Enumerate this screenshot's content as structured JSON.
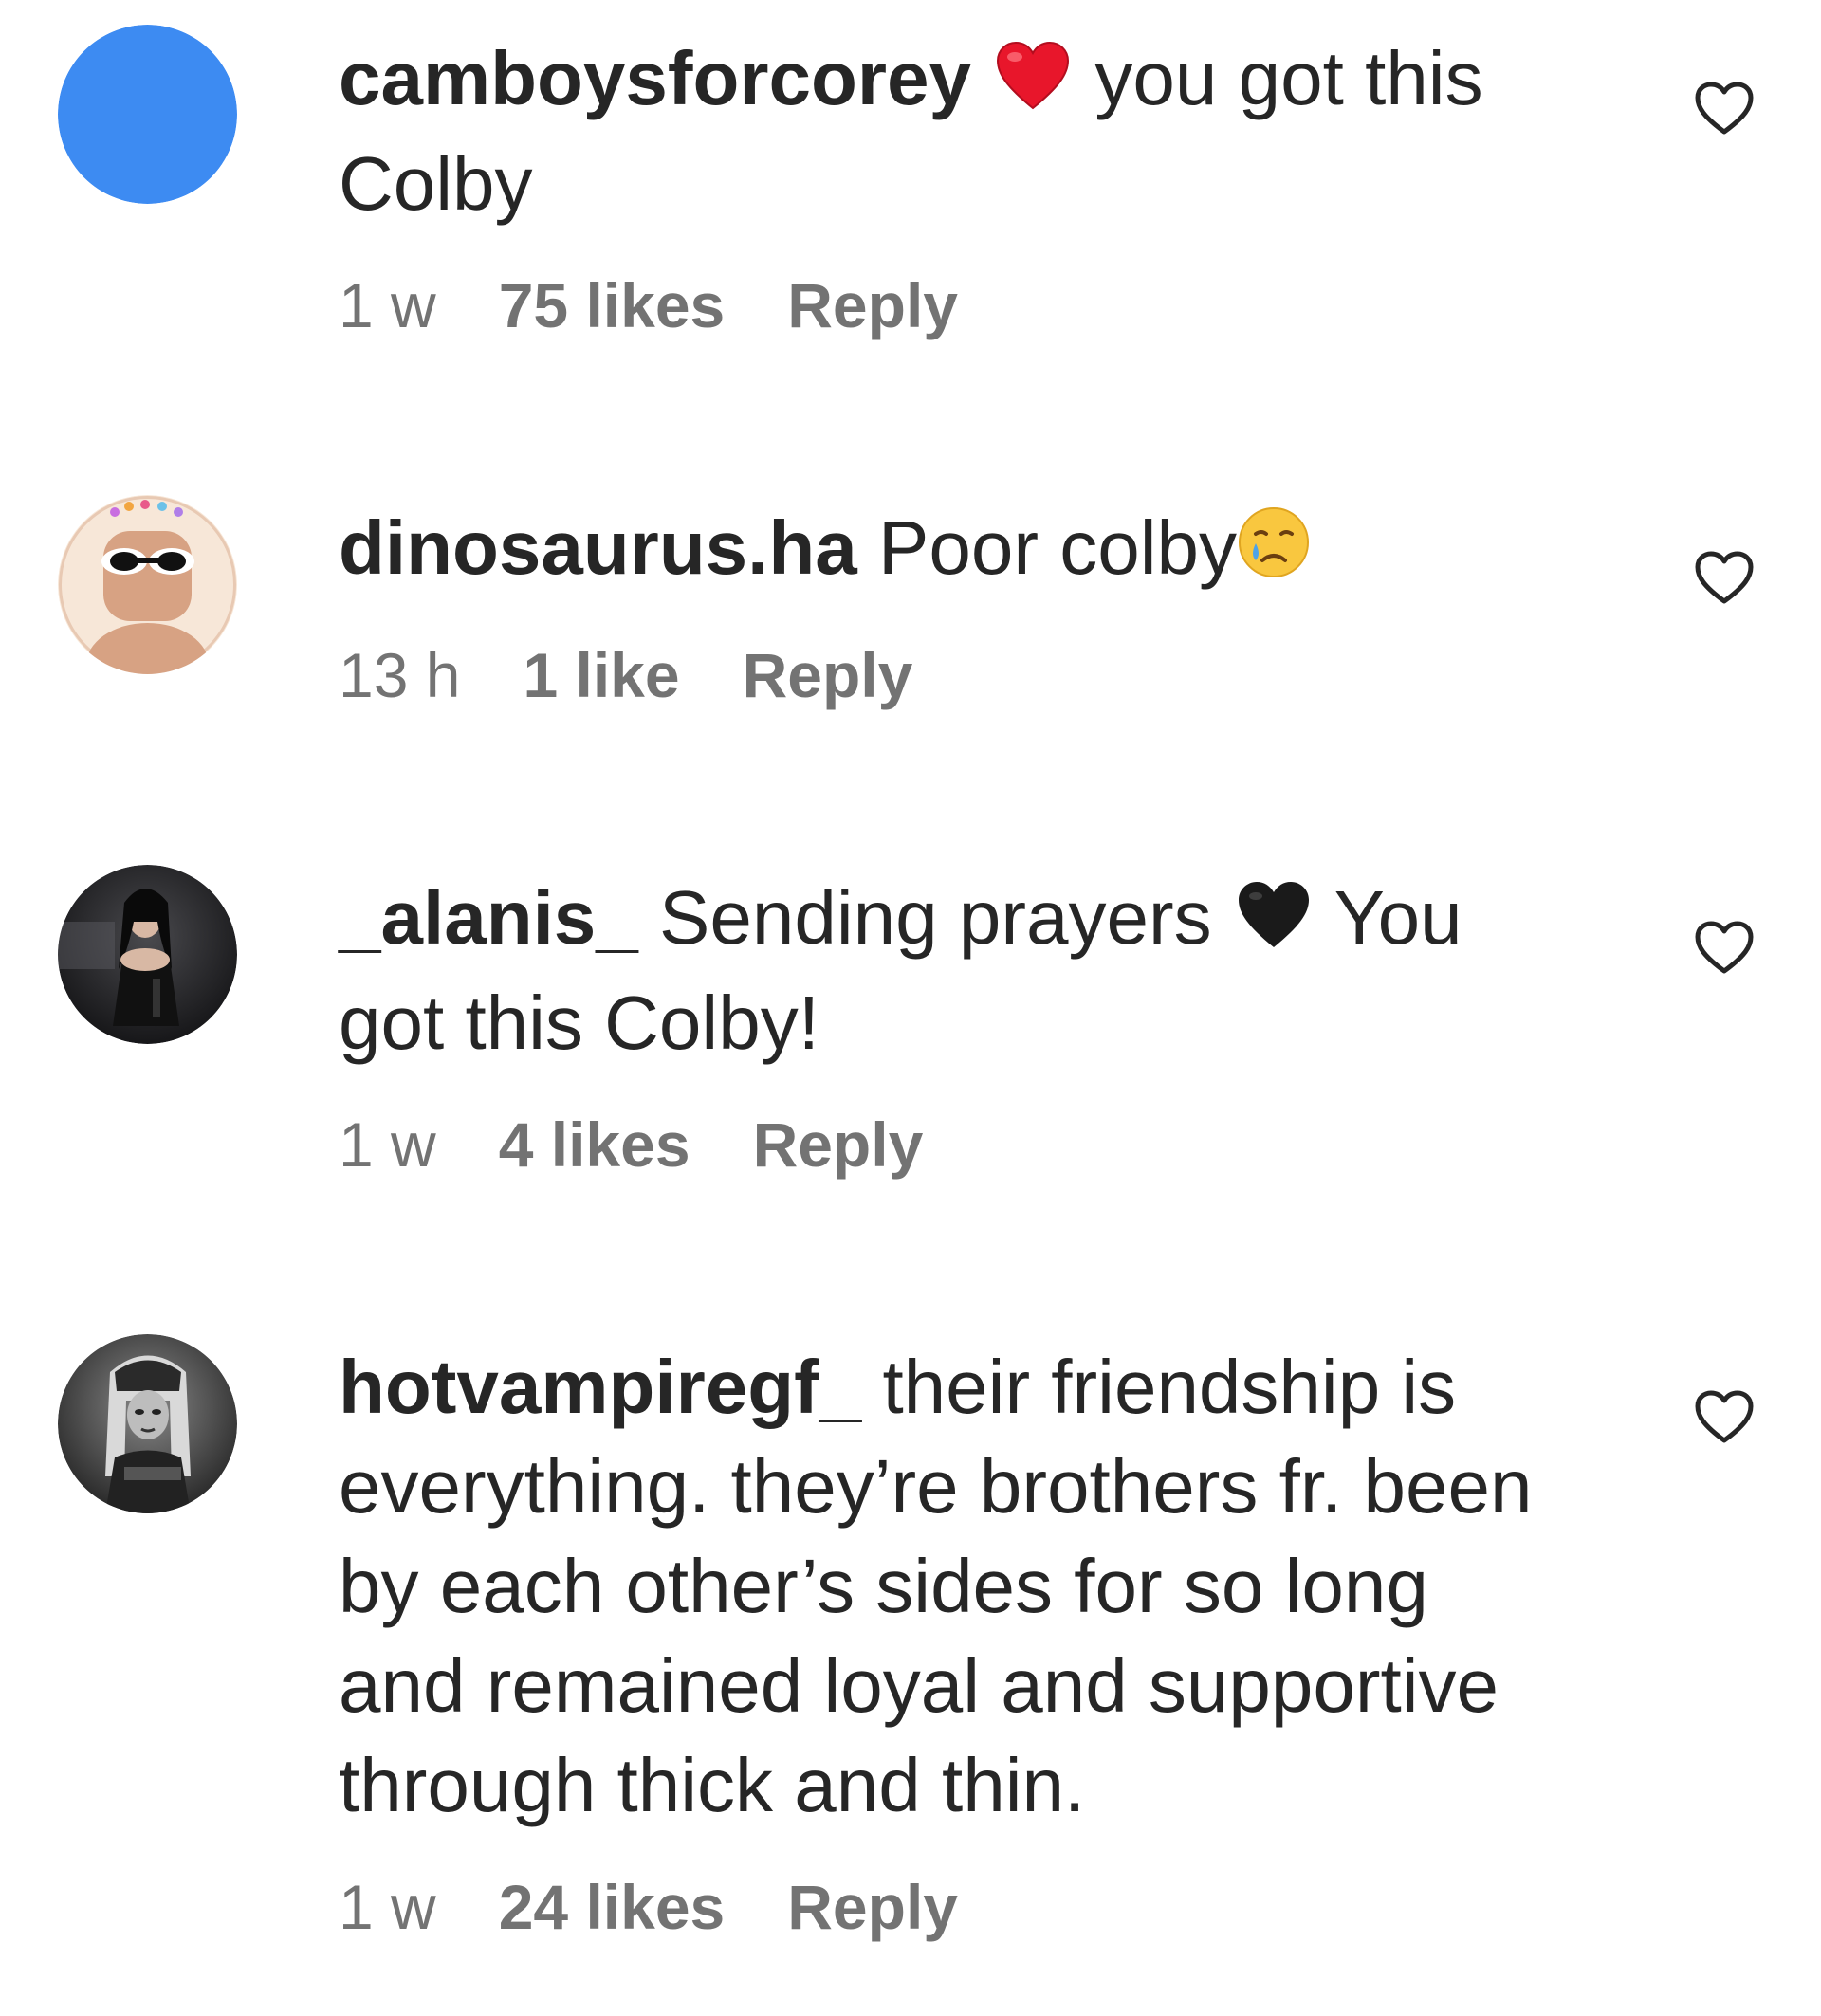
{
  "colors": {
    "text": "#262626",
    "meta": "#737373",
    "avatar_blue": "#3d8bf2"
  },
  "comments": [
    {
      "username": "camboysforcorey",
      "emoji": "red-heart",
      "text": "you got this Colby",
      "time": "1 w",
      "likes": "75 likes",
      "reply": "Reply",
      "avatar": "solid-blue-avatar"
    },
    {
      "username": "dinosaurus.ha",
      "text": "Poor colby",
      "emoji": "crying-face",
      "time": "13 h",
      "likes": "1 like",
      "reply": "Reply",
      "avatar": "cartoon-sunglasses-avatar"
    },
    {
      "username": "_alanis_",
      "text_before": "Sending prayers",
      "emoji": "black-heart",
      "text_after": "You got this Colby!",
      "time": "1 w",
      "likes": "4 likes",
      "reply": "Reply",
      "avatar": "dark-photo-avatar"
    },
    {
      "username": "hotvampiregf_",
      "text": "their friendship is everything. they’re brothers fr. been by each other’s sides for so long and remained loyal and supportive through thick and thin.",
      "time": "1 w",
      "likes": "24 likes",
      "reply": "Reply",
      "avatar": "grayscale-doll-avatar"
    }
  ]
}
